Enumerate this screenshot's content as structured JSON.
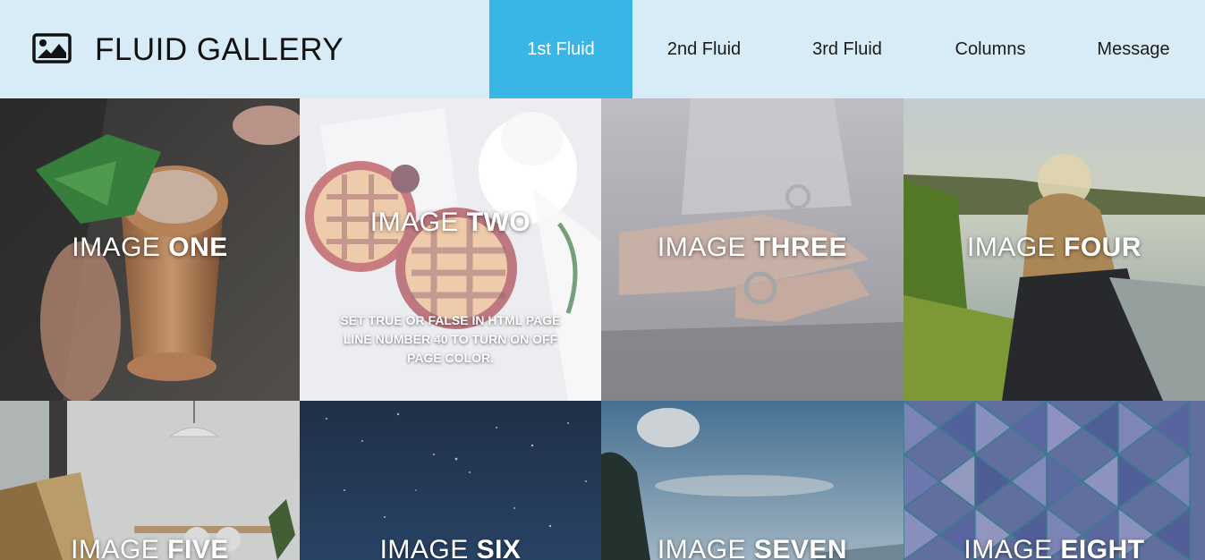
{
  "header": {
    "brand_icon": "image-icon",
    "brand_title": "FLUID GALLERY",
    "nav": [
      {
        "label": "1st Fluid",
        "active": true
      },
      {
        "label": "2nd Fluid",
        "active": false
      },
      {
        "label": "3rd Fluid",
        "active": false
      },
      {
        "label": "Columns",
        "active": false
      },
      {
        "label": "Message",
        "active": false
      }
    ],
    "accent_color": "#3ab6e6",
    "background_color": "#d7ecf7"
  },
  "gallery": {
    "tiles": [
      {
        "caption_light": "IMAGE ",
        "caption_bold": "ONE"
      },
      {
        "caption_light": "IMAGE ",
        "caption_bold": "TWO",
        "note": "SET TRUE OR FALSE IN HTML PAGE LINE NUMBER 40 TO TURN ON OFF PAGE COLOR."
      },
      {
        "caption_light": "IMAGE ",
        "caption_bold": "THREE"
      },
      {
        "caption_light": "IMAGE ",
        "caption_bold": "FOUR"
      },
      {
        "caption_light": "IMAGE ",
        "caption_bold": "FIVE"
      },
      {
        "caption_light": "IMAGE ",
        "caption_bold": "SIX"
      },
      {
        "caption_light": "IMAGE ",
        "caption_bold": "SEVEN"
      },
      {
        "caption_light": "IMAGE ",
        "caption_bold": "EIGHT"
      }
    ]
  }
}
